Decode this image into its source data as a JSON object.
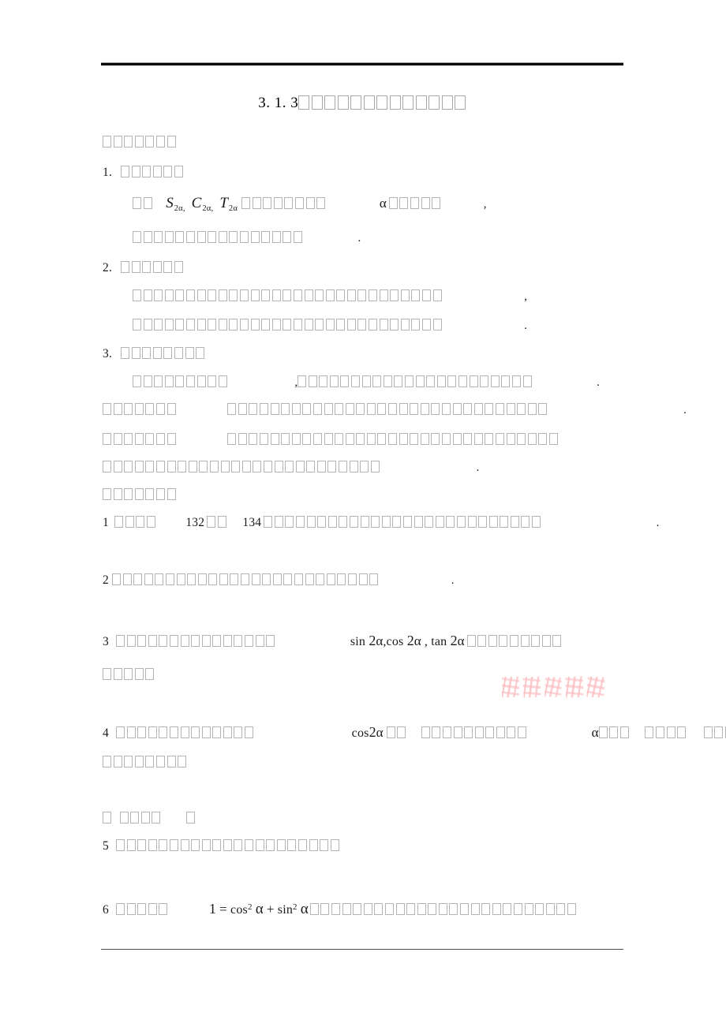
{
  "document": {
    "title_number": "3. 1. 3",
    "title_text_cjk_count": 13,
    "title_text": "二倍角的正弦、余弦、正切公式"
  },
  "rules": {
    "top_color": "#000000",
    "top_hairline_color": "#9a9a9a",
    "bottom_color": "#4a4a4a"
  },
  "watermark": {
    "text": "学考资源网",
    "color": "#fa9a9b",
    "char_count": 5
  },
  "sections": [
    {
      "id": "objectives-heading",
      "label": "【学习目标】",
      "cjk_count": 7
    },
    {
      "id": "objective-1",
      "number": "1.",
      "label": "知识与技能",
      "cjk_count": 6
    },
    {
      "id": "objective-1-body-a",
      "prefix_label": "以角",
      "prefix_cjk_count": 2,
      "math": "S2a_C2a_T2a",
      "mid_label": "为基础推导二倍角",
      "mid_cjk_count": 8,
      "alpha": "α",
      "tail_label": "的正弦余弦",
      "tail_cjk_count": 5,
      "punct": ","
    },
    {
      "id": "objective-1-body-b",
      "label": "正切公式并能灵活运用公式解决问题",
      "cjk_count": 16,
      "punct": "."
    },
    {
      "id": "objective-2",
      "number": "2.",
      "label": "过程与方法",
      "cjk_count": 6
    },
    {
      "id": "objective-2-body-a",
      "label": "通过对两角和的正弦余弦正切公式的推导引导学生发现二倍角公式",
      "cjk_count": 29,
      "punct": ","
    },
    {
      "id": "objective-2-body-b",
      "label": "体会由一般到特殊的数学思想培养学生的逻辑推理能力",
      "cjk_count": 29,
      "punct": "."
    },
    {
      "id": "objective-3",
      "number": "3.",
      "label": "情感态度与价值观",
      "cjk_count": 8
    },
    {
      "id": "objective-3-body",
      "label": "通过公式的推导过程",
      "cjk_count": 9,
      "punct": ",",
      "label2": "体会从一般到特殊的化归思想培养学生的探索精神",
      "cjk_count2": 22,
      "punct2": "."
    },
    {
      "id": "key-point",
      "label": "【学习重点】",
      "cjk_count": 7,
      "body": "二倍角的正弦余弦正切公式的推导以及公式的灵活运用",
      "body_cjk_count": 30,
      "punct": "."
    },
    {
      "id": "difficult-point",
      "label": "【学习难点】",
      "cjk_count": 7,
      "body": "二倍角公式的正用逆用变形使用以及与其他三角公式的综合运用",
      "body_cjk_count": 31
    },
    {
      "id": "difficult-point-cont",
      "label": "解决问题时公式的灵活选择与恒等变形技巧的综合应用能力",
      "cjk_count": 26,
      "punct": "."
    },
    {
      "id": "process-heading",
      "label": "【学习过程】",
      "cjk_count": 7
    }
  ],
  "questions": [
    {
      "number": "1",
      "prefix": "阅读教材",
      "prefix_cjk_count": 4,
      "page_from": "132",
      "mid": "页至",
      "mid_cjk_count": 2,
      "page_to": "134",
      "body": "页上半部分内容完成下列问题并把自己的疑惑写出来",
      "body_cjk_count": 26,
      "punct": "."
    },
    {
      "number": "2",
      "body": "两角和的正弦余弦正切公式分别是什么请默写出来",
      "body_cjk_count": 25,
      "punct": "."
    },
    {
      "number": "3",
      "body_a": "在上述公式中令两角相等即可得到",
      "body_a_cjk_count": 15,
      "math": "sin2a_cos2a_tan2a",
      "body_b": "的公式请把它们写出",
      "body_b_cjk_count": 9,
      "body_c": "来并记住",
      "body_c_cjk_count": 5
    },
    {
      "number": "4",
      "body_a": "结合同角三角函数基本关系式",
      "body_a_cjk_count": 13,
      "math": "cos2a",
      "body_a2": "还有",
      "body_a2_cjk_count": 2,
      "body_b": "什么等价的表达形式用",
      "body_b_cjk_count": 10,
      "alpha": "α",
      "body_c": "的正弦",
      "body_c_cjk_count": 3,
      "body_d": "余弦分别",
      "body_d_cjk_count": 4,
      "body_e": "表示出",
      "body_e_cjk_count": 3,
      "body_f": "来请写出推导过程",
      "body_f_cjk_count": 8
    },
    {
      "number": "",
      "body": "提示 配方法",
      "label_a": "提示",
      "label_a_cjk_count": 1,
      "label_b": "配方法",
      "label_b_cjk_count": 4,
      "label_c": "等",
      "label_c_cjk_count": 1
    },
    {
      "number": "5",
      "body": "倍角公式中的倍角只能是二倍角吗请举例说明",
      "body_cjk_count": 21
    },
    {
      "number": "6",
      "prefix": "你能利用",
      "prefix_cjk_count": 5,
      "math": "1_eq_cos2a_plus_sin2a",
      "body": "将二倍角的正弦公式化为其他形式吗试试看",
      "body_cjk_count": 25
    }
  ]
}
